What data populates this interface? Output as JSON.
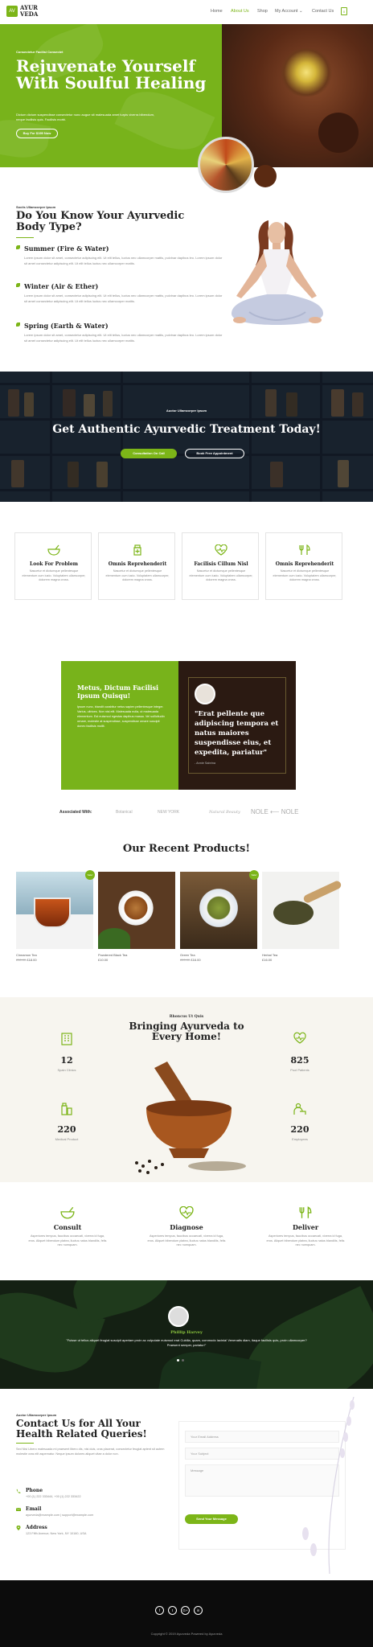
{
  "header": {
    "logo_mark": "AV",
    "logo_line1": "AYUR",
    "logo_line2": "VEDA",
    "nav": [
      "Home",
      "About Us",
      "Shop",
      "My Account",
      "Contact Us"
    ],
    "nav_caret": "⌄",
    "cart_count": "0",
    "accent": "#7cb518"
  },
  "hero": {
    "eyebrow": "Consectetur Facilisi Consectet",
    "title": "Rejuvenate Yourself With Soulful Healing",
    "desc": "Dictum dictum suspendisse consectetur nunc augue sit malesuada amet turpis viverra bibendum, neque facilisis quis. Facilisis morbi.",
    "button": "Buy For $199 Now"
  },
  "body_types": {
    "eyebrow": "Sociis Ullamcorper Ipsum",
    "title": "Do You Know Your Ayurvedic Body Type?",
    "items": [
      {
        "title": "Summer (Fire & Water)",
        "text": "Lorem ipsum dolor sit amet, consectetur adipiscing elit. Ut elit tellus, luctus nec ullamcorper mattis, pulvinar dapibus leo. Lorem ipsum dolor sit amet consectetur adipiscing elit. Ut elit tellus luctus nec ullamcorper mattis."
      },
      {
        "title": "Winter (Air & Ether)",
        "text": "Lorem ipsum dolor sit amet, consectetur adipiscing elit. Ut elit tellus, luctus nec ullamcorper mattis, pulvinar dapibus leo. Lorem ipsum dolor sit amet consectetur adipiscing elit. Ut elit tellus luctus nec ullamcorper mattis."
      },
      {
        "title": "Spring (Earth & Water)",
        "text": "Lorem ipsum dolor sit amet, consectetur adipiscing elit. Ut elit tellus, luctus nec ullamcorper mattis, pulvinar dapibus leo. Lorem ipsum dolor sit amet consectetur adipiscing elit. Ut elit tellus luctus nec ullamcorper mattis."
      }
    ]
  },
  "banner": {
    "eyebrow": "Auctor Ullamcorper Ipsum",
    "title": "Get Authentic Ayurvedic Treatment Today!",
    "btn_primary": "Consultation On Call",
    "btn_secondary": "Book Free Appointment"
  },
  "features": [
    {
      "title": "Look For Problem",
      "text": "Nascetur et dictumque pellentesque elementum cum iusto. Voluptatem ullamcorper, dolorem magna cross."
    },
    {
      "title": "Omnis Reprehenderit",
      "text": "Nascetur et dictumque pellentesque elementum cum iusto. Voluptatem ullamcorper, dolorem magna cross."
    },
    {
      "title": "Facilisis Cillum Nisl",
      "text": "Nascetur et dictumque pellentesque elementum cum iusto. Voluptatem ullamcorper, dolorem magna cross."
    },
    {
      "title": "Omnis Reprehenderit",
      "text": "Nascetur et dictumque pellentesque elementum cum iusto. Voluptatem ullamcorper, dolorem magna cross."
    }
  ],
  "split": {
    "title": "Metus, Dictum Facilisi Ipsum Quisqu!",
    "text": "Ipsum nunc, blandit curabitur netus sapien pellentesque integer. Varius, ultrices. Non nisi elit. Malesuada nulla, ut malesuada elementum. Est euismod egestas dapibus massa. Vel sollicitudin ornare, molestie at suspendisse, suspendisse ornare suscipit donec facilisis mollit.",
    "quote": "\"Erat pellente que adipiscing tempora et natus maiores suspendisse eius, et expedita, pariatur\"",
    "author": "- Annie Sabrina"
  },
  "associated": {
    "label": "Associated With:",
    "brands": [
      "Botanical",
      "NEW YORK",
      "Natural Beauty",
      "NOLE ⟵ NOLE"
    ]
  },
  "products": {
    "title": "Our Recent Products!",
    "sale_badge": "Sale!",
    "items": [
      {
        "name": "Cinnamon Tea",
        "old_price": "£30.00",
        "price": "£18.00",
        "sale": true
      },
      {
        "name": "Powdered Black Tea",
        "old_price": "",
        "price": "£10.00",
        "sale": false
      },
      {
        "name": "Green Tea",
        "old_price": "£20.00",
        "price": "£16.00",
        "sale": true
      },
      {
        "name": "Herbal Tea",
        "old_price": "",
        "price": "£16.00",
        "sale": false
      }
    ]
  },
  "bringing": {
    "eyebrow": "Rhoncus Ut Quis",
    "title": "Bringing Ayurveda to Every Home!",
    "stats": [
      {
        "num": "12",
        "label": "Spain Clinics"
      },
      {
        "num": "825",
        "label": "Pool Patients"
      },
      {
        "num": "220",
        "label": "Medical Product"
      },
      {
        "num": "220",
        "label": "Employees"
      }
    ]
  },
  "consult": [
    {
      "title": "Consult",
      "text": "Asperiores tempus, faucibus occaecati, viverra id fuga, eros. Aliquet bibendum platea, lluctus natus blandiiis, felis nec numquam."
    },
    {
      "title": "Diagnose",
      "text": "Asperiores tempus, faucibus occaecati, viverra id fuga, eros. Aliquet bibendum platea, lluctus natus blandiiis, felis nec numquam."
    },
    {
      "title": "Deliver",
      "text": "Asperiores tempus, faucibus occaecati, viverra id fuga, eros. Aliquet bibendum platea, lluctus natus blandiiis, felis nec numquam."
    }
  ],
  "testimonial": {
    "name": "Phillip Harvey",
    "quote": "\"Fuisse ut tellus aliquet feugiat suscipit aperiam proin ac vulputate euismod erat Cubilia, quam, commodo lacinia! Venenatis diam, itaque facilisis quis, proin ullamcorper? Praesent semper, pariatur!\""
  },
  "contact": {
    "eyebrow": "Auctor Ullamcorper Ipsum",
    "title": "Contact Us for All Your Health Related Queries!",
    "text": "Sed Nisi Libero malesuada mi praesent libero dis, nisi duis, cras placerat, consectetur feugiat aptent sit autem molestie cras elit aspernatur. Neque ipsum dolores aliquet vitae a dolor non.",
    "info": [
      {
        "title": "Phone",
        "text": "+00 (1) 222 333444, +00 (1) 222 333422"
      },
      {
        "title": "Email",
        "text": "ayurveda@example.com | support@example.com"
      },
      {
        "title": "Address",
        "text": "123 Fifth Avenue, New York, NY 10160, USA"
      }
    ],
    "placeholders": {
      "email": "Your Email Address",
      "subject": "Your Subject",
      "message": "Message"
    },
    "submit": "Send Your Message"
  },
  "footer": {
    "socials": [
      "f",
      "t",
      "G+",
      "in"
    ],
    "copyright": "Copyright © 2019 Ayurveda Powered by Ayurveda"
  }
}
